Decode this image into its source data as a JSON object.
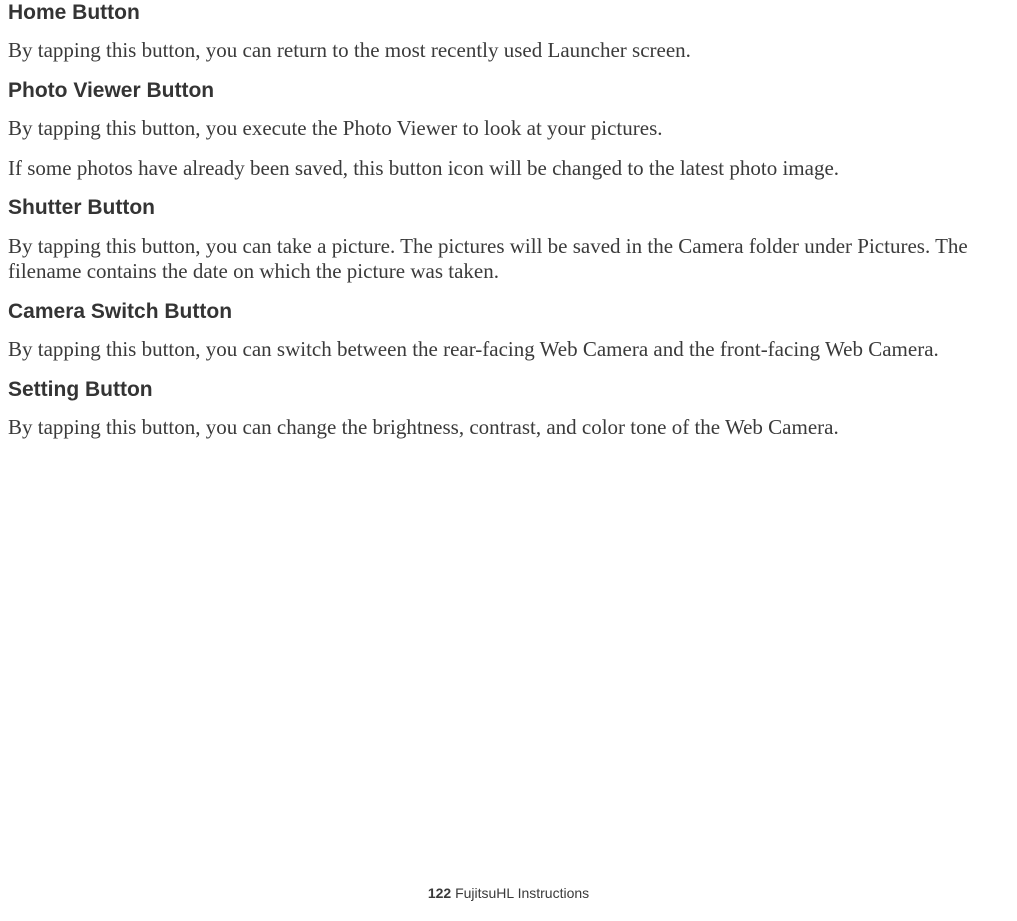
{
  "sections": [
    {
      "heading": "Home Button",
      "paragraphs": [
        "By tapping this button, you can return to the most recently used Launcher screen."
      ]
    },
    {
      "heading": "Photo Viewer Button",
      "paragraphs": [
        "By tapping this button, you execute the Photo Viewer to look at your pictures.",
        "If some photos have already been saved, this button icon will be changed to the latest photo image."
      ]
    },
    {
      "heading": "Shutter Button",
      "paragraphs": [
        "By tapping this button, you can take a picture. The pictures will be saved in the Camera folder under Pictures. The filename contains the date on which the picture was taken."
      ]
    },
    {
      "heading": "Camera Switch Button",
      "paragraphs": [
        "By tapping this button, you can switch between the rear-facing Web Camera and the front-facing Web Camera."
      ]
    },
    {
      "heading": "Setting Button",
      "paragraphs": [
        "By tapping this button, you can change the brightness, contrast, and color tone of the Web Camera."
      ]
    }
  ],
  "footer": {
    "page_number": "122",
    "title": " FujitsuHL Instructions"
  }
}
